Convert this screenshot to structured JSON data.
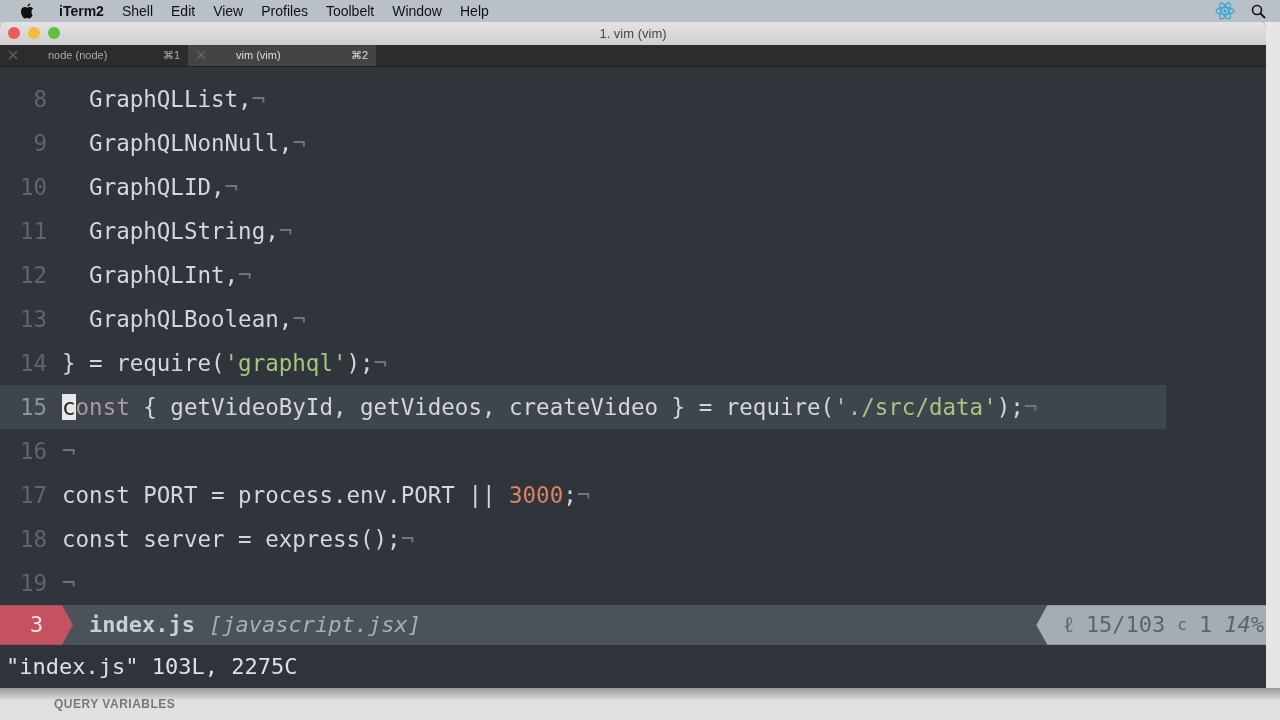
{
  "menu_bar": {
    "app": "iTerm2",
    "items": [
      "Shell",
      "Edit",
      "View",
      "Profiles",
      "Toolbelt",
      "Window",
      "Help"
    ]
  },
  "window": {
    "title": "1. vim (vim)"
  },
  "tabs": [
    {
      "label": "node (node)",
      "shortcut": "⌘1",
      "selected": false
    },
    {
      "label": "vim (vim)",
      "shortcut": "⌘2",
      "selected": true
    }
  ],
  "editor": {
    "lines": [
      {
        "number": "8",
        "current": false,
        "tokens": [
          {
            "kind": "plain",
            "text": "  GraphQLList,"
          },
          {
            "kind": "eol",
            "text": "¬"
          }
        ]
      },
      {
        "number": "9",
        "current": false,
        "tokens": [
          {
            "kind": "plain",
            "text": "  GraphQLNonNull,"
          },
          {
            "kind": "eol",
            "text": "¬"
          }
        ]
      },
      {
        "number": "10",
        "current": false,
        "tokens": [
          {
            "kind": "plain",
            "text": "  GraphQLID,"
          },
          {
            "kind": "eol",
            "text": "¬"
          }
        ]
      },
      {
        "number": "11",
        "current": false,
        "tokens": [
          {
            "kind": "plain",
            "text": "  GraphQLString,"
          },
          {
            "kind": "eol",
            "text": "¬"
          }
        ]
      },
      {
        "number": "12",
        "current": false,
        "tokens": [
          {
            "kind": "plain",
            "text": "  GraphQLInt,"
          },
          {
            "kind": "eol",
            "text": "¬"
          }
        ]
      },
      {
        "number": "13",
        "current": false,
        "tokens": [
          {
            "kind": "plain",
            "text": "  GraphQLBoolean,"
          },
          {
            "kind": "eol",
            "text": "¬"
          }
        ]
      },
      {
        "number": "14",
        "current": false,
        "tokens": [
          {
            "kind": "plain",
            "text": "} = require("
          },
          {
            "kind": "string",
            "text": "'graphql'"
          },
          {
            "kind": "plain",
            "text": ");"
          },
          {
            "kind": "eol",
            "text": "¬"
          }
        ]
      },
      {
        "number": "15",
        "current": true,
        "tokens": [
          {
            "kind": "cursor",
            "text": "c"
          },
          {
            "kind": "keyword",
            "text": "onst"
          },
          {
            "kind": "plain",
            "text": " { getVideoById, getVideos, createVideo } = require("
          },
          {
            "kind": "string",
            "text": "'./src/data'"
          },
          {
            "kind": "plain",
            "text": ");"
          },
          {
            "kind": "eol",
            "text": "¬"
          }
        ]
      },
      {
        "number": "16",
        "current": false,
        "tokens": [
          {
            "kind": "eol",
            "text": "¬"
          }
        ]
      },
      {
        "number": "17",
        "current": false,
        "tokens": [
          {
            "kind": "plain",
            "text": "const PORT = process.env.PORT || "
          },
          {
            "kind": "number",
            "text": "3000"
          },
          {
            "kind": "plain",
            "text": ";"
          },
          {
            "kind": "eol",
            "text": "¬"
          }
        ]
      },
      {
        "number": "18",
        "current": false,
        "tokens": [
          {
            "kind": "plain",
            "text": "const server = express();"
          },
          {
            "kind": "eol",
            "text": "¬"
          }
        ]
      },
      {
        "number": "19",
        "current": false,
        "tokens": [
          {
            "kind": "eol",
            "text": "¬"
          }
        ]
      }
    ]
  },
  "status_line": {
    "mode": "3",
    "filename": "index.js",
    "filetype": "[javascript.jsx]",
    "line_icon": "ℓ",
    "position": "15/103",
    "column_icon": "c",
    "column": "1",
    "percent": "14%"
  },
  "command_line": "\"index.js\" 103L, 2275C",
  "background_panel": {
    "label": "QUERY VARIABLES"
  }
}
